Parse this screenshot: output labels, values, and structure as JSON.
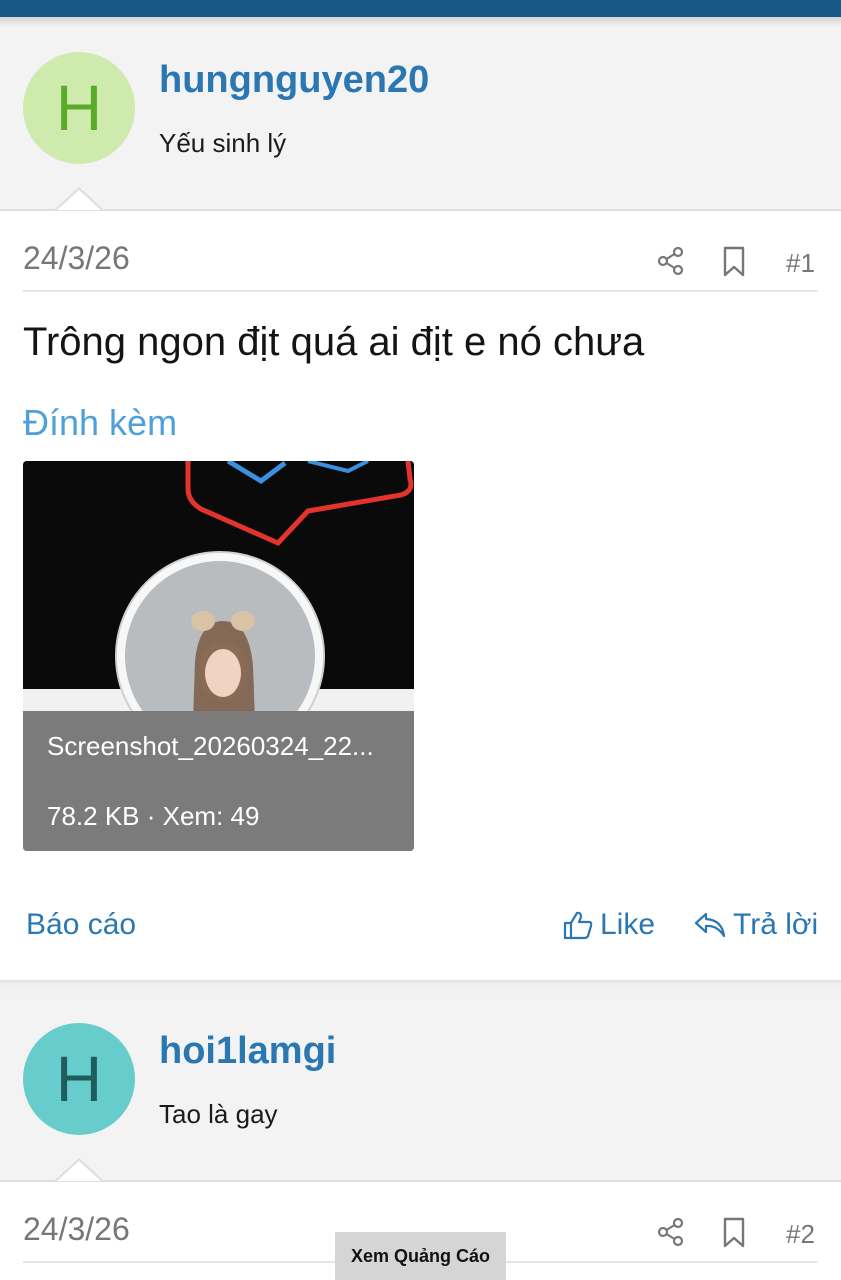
{
  "posts": [
    {
      "avatar_letter": "H",
      "avatar_bg": "#cfeaad",
      "avatar_fg": "#5aab29",
      "username": "hungnguyen20",
      "user_title": "Yếu sinh lý",
      "date": "24/3/26",
      "post_number": "#1",
      "message": "Trông ngon địt quá ai địt e nó chưa",
      "attachments_title": "Đính kèm",
      "attachment": {
        "filename": "Screenshot_20260324_22...",
        "meta": "78.2 KB · Xem: 49"
      },
      "actions": {
        "report": "Báo cáo",
        "like": "Like",
        "reply": "Trả lời"
      }
    },
    {
      "avatar_letter": "H",
      "avatar_bg": "#66cccc",
      "avatar_fg": "#1f5c5c",
      "username": "hoi1lamgi",
      "user_title": "Tao là gay",
      "date": "24/3/26",
      "post_number": "#2"
    }
  ],
  "ad_button": "Xem Quảng Cáo",
  "icons": {
    "share": "share-icon",
    "bookmark": "bookmark-icon",
    "like": "thumbs-up-icon",
    "reply": "reply-icon"
  },
  "colors": {
    "topbar": "#185886",
    "link": "#2b77b1",
    "attach_title": "#4fa0d8"
  }
}
